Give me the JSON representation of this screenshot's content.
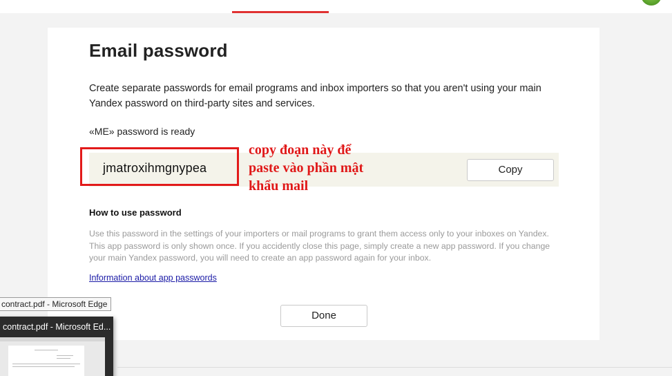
{
  "page": {
    "title": "Email password",
    "description": "Create separate passwords for email programs and inbox importers so that you aren't using your main Yandex password on third-party sites and services.",
    "ready_text": "«ME» password is ready",
    "password": "jmatroxihmgnypea",
    "copy_label": "Copy",
    "annotation": "copy đoạn này để\npaste vào phần mật\nkhẩu mail",
    "howto_title": "How to use password",
    "howto_body": "Use this password in the settings of your importers or mail programs to grant them access only to your inboxes on Yandex. This app password is only shown once. If you accidently close this page, simply create a new app password. If you change your main Yandex password, you will need to create an app password again for your inbox.",
    "info_link": "Information about app passwords",
    "done_label": "Done"
  },
  "taskbar": {
    "tooltip": "contract.pdf - Microsoft Edge",
    "preview_title": "contract.pdf - Microsoft Ed..."
  },
  "colors": {
    "accent_red": "#e21a1a",
    "link_blue": "#1a1aa6",
    "password_row_bg": "#f4f3ea"
  }
}
